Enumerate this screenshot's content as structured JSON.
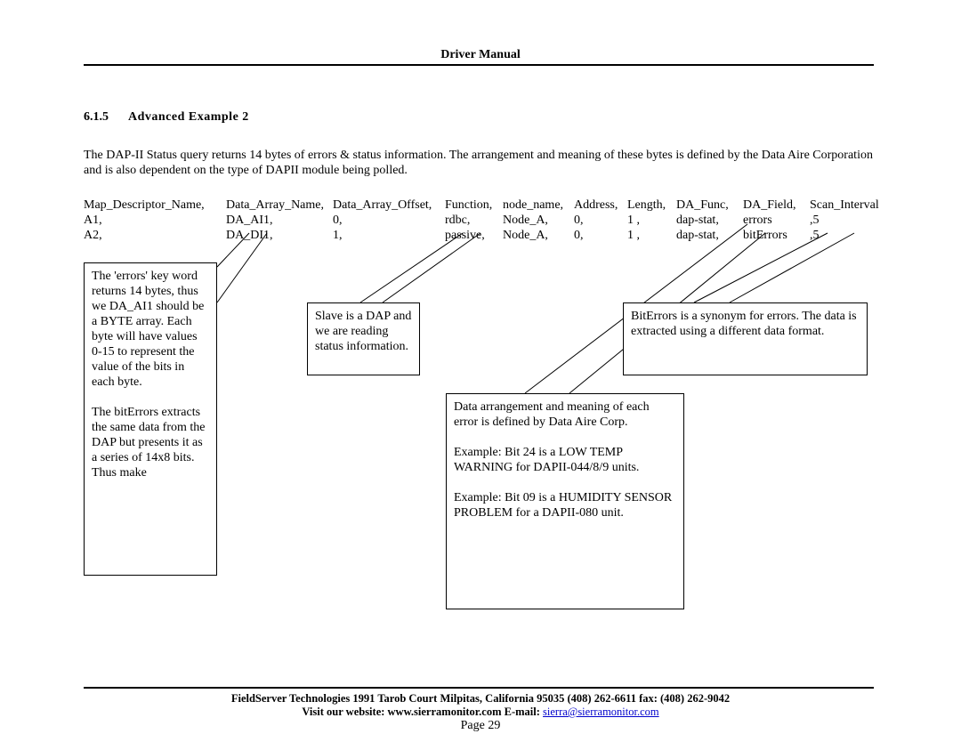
{
  "header": {
    "title": "Driver Manual"
  },
  "section": {
    "number": "6.1.5",
    "title": "Advanced Example 2"
  },
  "para": "The DAP-II Status query returns 14 bytes of errors & status information. The arrangement and meaning of these bytes is defined by the Data Aire Corporation and is also dependent on the type of DAPII module being polled.",
  "table": {
    "headers": [
      "Map_Descriptor_Name,",
      "Data_Array_Name,",
      "Data_Array_Offset,",
      "Function,",
      "node_name,",
      "Address,",
      "Length,",
      "DA_Func,",
      "DA_Field,",
      "Scan_Interval"
    ],
    "rows": [
      [
        "A1,",
        "DA_AI1,",
        "0,",
        "rdbc,",
        "Node_A,",
        "0,",
        "1 ,",
        "dap-stat,",
        "errors",
        ",5"
      ],
      [
        "A2,",
        "DA_DI1,",
        "1,",
        "passive,",
        "Node_A,",
        "0,",
        "1 ,",
        "dap-stat,",
        "bitErrors",
        ",5"
      ]
    ]
  },
  "callouts": {
    "a": "The 'errors' key word returns 14 bytes, thus we DA_AI1 should be a BYTE array. Each byte will have values 0-15 to represent the value of the bits in each byte.\n\nThe bitErrors extracts the same data from the DAP but presents it as a series of 14x8 bits. Thus make",
    "b": "Slave is a DAP and we are reading status information.",
    "c": "Data arrangement and meaning of each error is defined by Data Aire Corp.\n\nExample: Bit 24 is a LOW TEMP WARNING for DAPII-044/8/9 units.\n\nExample: Bit 09 is a HUMIDITY SENSOR PROBLEM for a DAPII-080 unit.",
    "d": "BitErrors is a synonym for errors. The data is extracted using a different data format."
  },
  "footer": {
    "line1": "FieldServer Technologies 1991 Tarob Court Milpitas, California 95035 (408) 262-6611 fax: (408) 262-9042",
    "line2_pre": "Visit our website: www.sierramonitor.com          E-mail: ",
    "line2_link": "sierra@sierramonitor.com",
    "page": "Page 29"
  }
}
